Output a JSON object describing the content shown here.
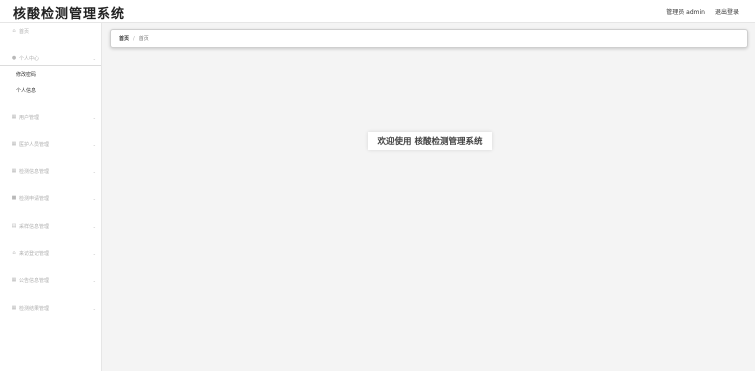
{
  "header": {
    "title": "核酸检测管理系统",
    "user_label": "管理员 admin",
    "logout_label": "退出登录"
  },
  "sidebar": {
    "home": {
      "icon": "home-icon",
      "label": "首页"
    },
    "personal_center": {
      "icon": "user-icon",
      "label": "个人中心",
      "children": [
        "修改密码",
        "个人信息"
      ]
    },
    "items": [
      {
        "icon": "grid-icon",
        "label": "用户管理"
      },
      {
        "icon": "grid-icon",
        "label": "医护人员管理"
      },
      {
        "icon": "grid-icon",
        "label": "检测信息管理"
      },
      {
        "icon": "chat-icon",
        "label": "检测申请管理"
      },
      {
        "icon": "document-icon",
        "label": "采样信息管理"
      },
      {
        "icon": "home-icon",
        "label": "来访登记管理"
      },
      {
        "icon": "grid-icon",
        "label": "公告信息管理"
      },
      {
        "icon": "grid-icon",
        "label": "检测结果管理"
      }
    ]
  },
  "breadcrumb": {
    "home": "首页",
    "separator": "/",
    "current": "首页"
  },
  "main": {
    "welcome": "欢迎使用 核酸检测管理系统"
  }
}
